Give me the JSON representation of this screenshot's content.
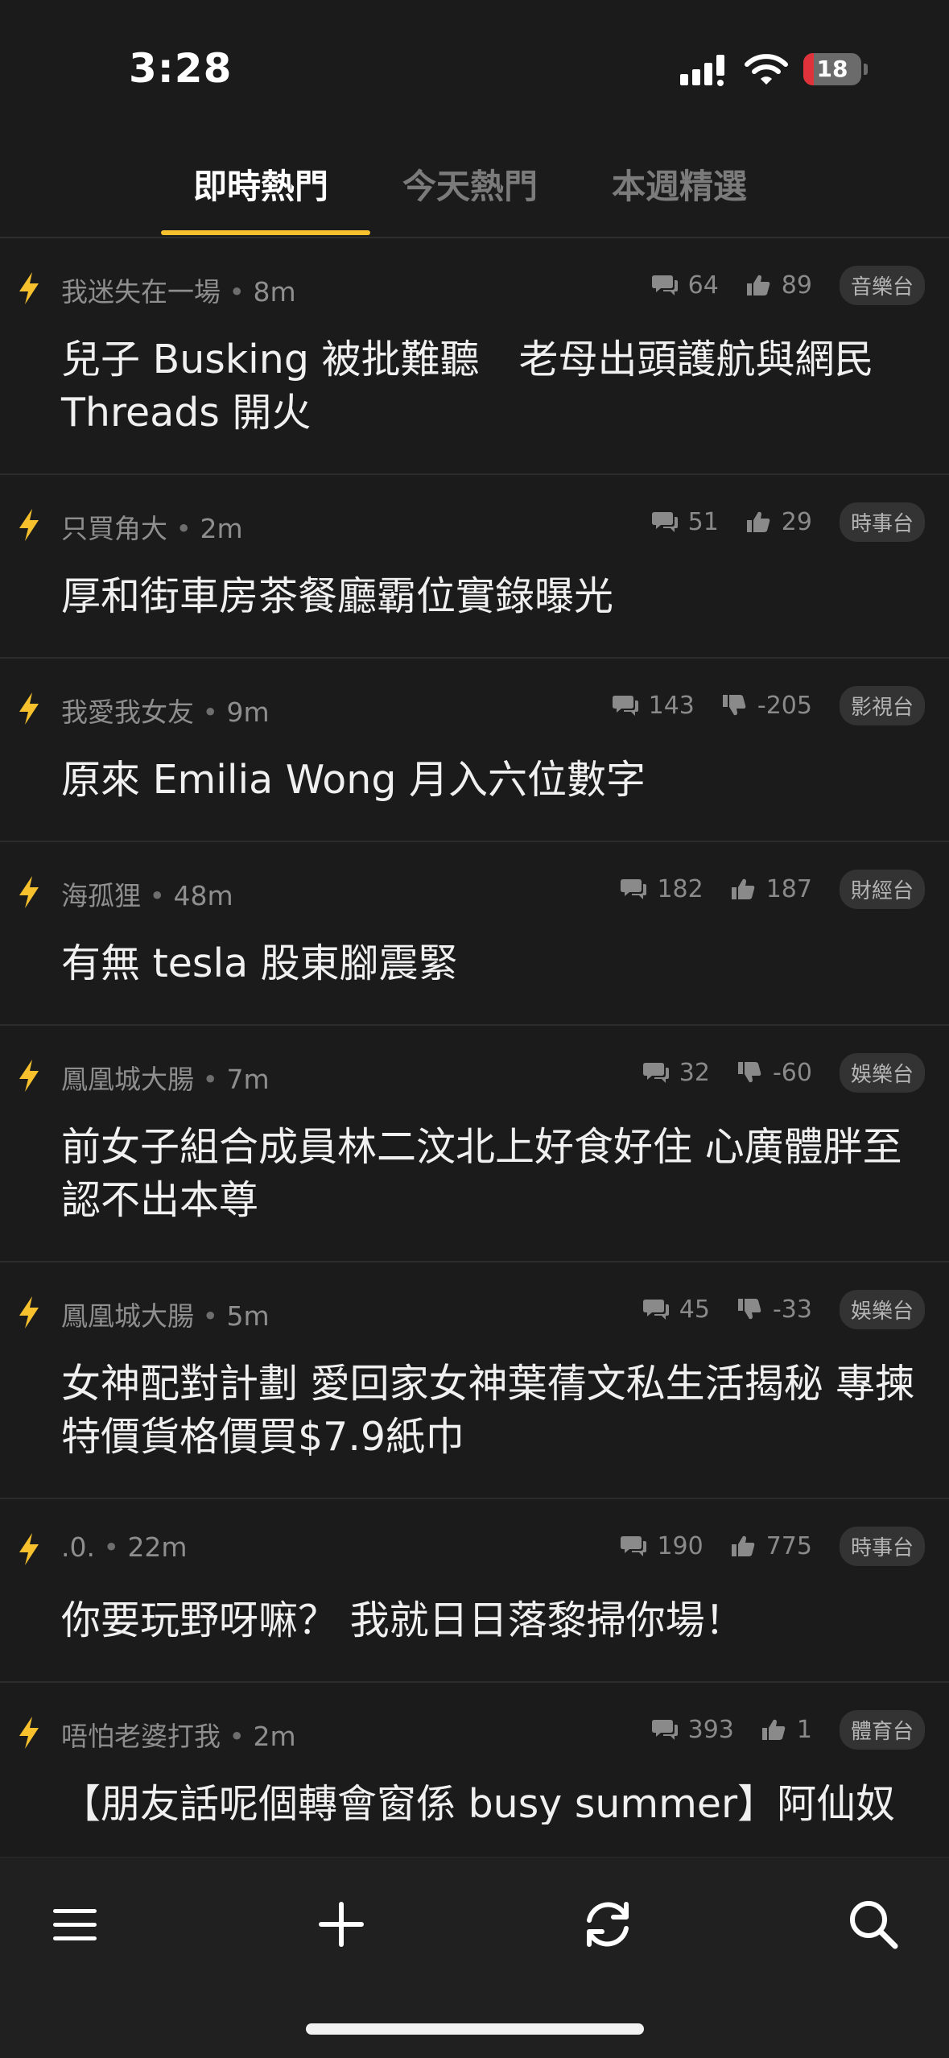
{
  "status": {
    "time": "3:28",
    "battery_level": "18",
    "battery_color": "#e0323a"
  },
  "tabs": [
    {
      "label": "即時熱門",
      "active": true
    },
    {
      "label": "今天熱門",
      "active": false
    },
    {
      "label": "本週精選",
      "active": false
    }
  ],
  "accent_color": "#f7c12e",
  "posts": [
    {
      "author": "我迷失在一場",
      "age": "8m",
      "comments": "64",
      "vote_icon": "thumbs-up-icon",
      "votes": "89",
      "board": "音樂台",
      "title": "兒子 Busking 被批難聽　老母出頭護航與網民 Threads 開火"
    },
    {
      "author": "只買角大",
      "age": "2m",
      "comments": "51",
      "vote_icon": "thumbs-up-icon",
      "votes": "29",
      "board": "時事台",
      "title": "厚和街車房茶餐廳霸位實錄曝光"
    },
    {
      "author": "我愛我女友",
      "age": "9m",
      "comments": "143",
      "vote_icon": "thumbs-down-icon",
      "votes": "-205",
      "board": "影視台",
      "title": "原來 Emilia Wong 月入六位數字"
    },
    {
      "author": "海孤狸",
      "age": "48m",
      "comments": "182",
      "vote_icon": "thumbs-up-icon",
      "votes": "187",
      "board": "財經台",
      "title": "有無 tesla 股東腳震緊"
    },
    {
      "author": "鳳凰城大腸",
      "age": "7m",
      "comments": "32",
      "vote_icon": "thumbs-down-icon",
      "votes": "-60",
      "board": "娛樂台",
      "title": "前女子組合成員林二汶北上好食好住 心廣體胖至認不出本尊"
    },
    {
      "author": "鳳凰城大腸",
      "age": "5m",
      "comments": "45",
      "vote_icon": "thumbs-down-icon",
      "votes": "-33",
      "board": "娛樂台",
      "title": "女神配對計劃 愛回家女神葉蒨文私生活揭秘 專揀特價貨格價買$7.9紙巾"
    },
    {
      "author": ".0.",
      "age": "22m",
      "comments": "190",
      "vote_icon": "thumbs-up-icon",
      "votes": "775",
      "board": "時事台",
      "title": "你要玩野呀嘛？ 我就日日落黎掃你場！"
    },
    {
      "author": "唔怕老婆打我",
      "age": "2m",
      "comments": "393",
      "vote_icon": "thumbs-up-icon",
      "votes": "1",
      "board": "體育台",
      "title": "【朋友話呢個轉會窗係 busy summer】阿仙奴"
    }
  ],
  "bottom_bar": {
    "icons": [
      "menu-icon",
      "plus-icon",
      "refresh-icon",
      "search-icon"
    ]
  }
}
